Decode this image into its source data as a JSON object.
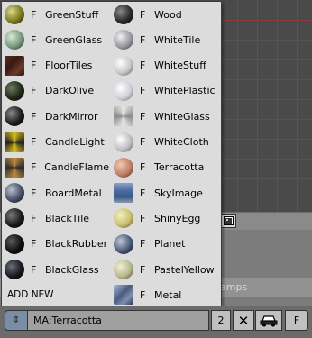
{
  "background": {
    "tab_label": "amps"
  },
  "popup": {
    "left_column": [
      {
        "flag": "F",
        "name": "GreenStuff",
        "thumb": "radial-gradient(circle at 35% 35%, #d9d98a, #7a7a20 55%, #2a2a05 90%)",
        "shape": "sphere"
      },
      {
        "flag": "F",
        "name": "GreenGlass",
        "thumb": "radial-gradient(circle at 35% 35%, #d8e8d0, #7a9a80 55%, #2e3e30 90%)",
        "shape": "sphere"
      },
      {
        "flag": "F",
        "name": "FloorTiles",
        "thumb": "linear-gradient(135deg, #5a2a1e, #3a1a12 40%, #6b3a2a 70%, #2a1410)",
        "shape": "square"
      },
      {
        "flag": "F",
        "name": "DarkOlive",
        "thumb": "radial-gradient(circle at 35% 35%, #6c7a5a, #1f2a18 55%, #050805 90%)",
        "shape": "sphere"
      },
      {
        "flag": "F",
        "name": "DarkMirror",
        "thumb": "radial-gradient(circle at 35% 35%, #8a8a8a, #1c1c1c 55%, #050505 90%)",
        "shape": "sphere"
      },
      {
        "flag": "F",
        "name": "CandleLight",
        "thumb": "conic-gradient(#d8c020, #1c1c1c, #d8c020, #1c1c1c, #d8c020)",
        "shape": "square"
      },
      {
        "flag": "F",
        "name": "CandleFlame",
        "thumb": "conic-gradient(#c08a40, #2a2a2a, #c08a40, #2a2a2a, #c08a40)",
        "shape": "square"
      },
      {
        "flag": "F",
        "name": "BoardMetal",
        "thumb": "radial-gradient(circle at 35% 35%, #b8c0d0, #4a5068 55%, #141824 90%)",
        "shape": "sphere"
      },
      {
        "flag": "F",
        "name": "BlackTile",
        "thumb": "radial-gradient(circle at 35% 35%, #7a7a7a, #1a1a1a 55%, #000 90%)",
        "shape": "sphere"
      },
      {
        "flag": "F",
        "name": "BlackRubber",
        "thumb": "radial-gradient(circle at 35% 35%, #5a5a5a, #101010 55%, #000 90%)",
        "shape": "sphere"
      },
      {
        "flag": "F",
        "name": "BlackGlass",
        "thumb": "radial-gradient(circle at 35% 35%, #6a6e78, #181a20 55%, #030305 90%)",
        "shape": "sphere"
      }
    ],
    "right_column": [
      {
        "flag": "F",
        "name": "Wood",
        "thumb": "radial-gradient(circle at 35% 35%, #8a8a8a, #2a2a2a 55%, #080808 90%)",
        "shape": "sphere"
      },
      {
        "flag": "F",
        "name": "WhiteTile",
        "thumb": "radial-gradient(circle at 35% 35%, #f0f0f0, #9a9aa0 55%, #4a4a50 90%)",
        "shape": "sphere"
      },
      {
        "flag": "F",
        "name": "WhiteStuff",
        "thumb": "radial-gradient(circle at 35% 35%, #ffffff, #c8c8c8 55%, #6a6a6a 90%)",
        "shape": "sphere"
      },
      {
        "flag": "F",
        "name": "WhitePlastic",
        "thumb": "radial-gradient(circle at 35% 35%, #ffffff, #d0d0d8 55%, #7a7a84 90%)",
        "shape": "sphere"
      },
      {
        "flag": "F",
        "name": "WhiteGlass",
        "thumb": "conic-gradient(#e8e8e8, #8a8a8a, #e8e8e8, #8a8a8a, #e8e8e8)",
        "shape": "square"
      },
      {
        "flag": "F",
        "name": "WhiteCloth",
        "thumb": "radial-gradient(circle at 35% 35%, #ffffff, #c0c0c0 55%, #707070 90%)",
        "shape": "sphere"
      },
      {
        "flag": "F",
        "name": "Terracotta",
        "thumb": "radial-gradient(circle at 35% 35%, #f0c8b0, #c08068 55%, #6a3a2a 90%)",
        "shape": "sphere"
      },
      {
        "flag": "F",
        "name": "SkyImage",
        "thumb": "linear-gradient(180deg, #8aa0c8, #4a6aa0 40%, #3a5888 70%, #8a9aa8)",
        "shape": "square"
      },
      {
        "flag": "F",
        "name": "ShinyEgg",
        "thumb": "radial-gradient(circle at 35% 35%, #f4f0c0, #c8c070 55%, #6a6430 90%)",
        "shape": "sphere"
      },
      {
        "flag": "F",
        "name": "Planet",
        "thumb": "radial-gradient(circle at 35% 35%, #c0c8d8, #4a5a7a 55%, #141a28 90%)",
        "shape": "sphere"
      },
      {
        "flag": "F",
        "name": "PastelYellow",
        "thumb": "radial-gradient(circle at 35% 35%, #f0f0d0, #b8b890 55%, #5a5a40 90%)",
        "shape": "sphere"
      },
      {
        "flag": "F",
        "name": "Metal",
        "thumb": "linear-gradient(135deg, #a8b8d0, #4a5a80 45%, #8090b0 70%, #2a3450)",
        "shape": "square"
      }
    ],
    "add_new_label": "ADD NEW"
  },
  "header": {
    "browse_icon": "updown-arrows-icon",
    "material_name": "MA:Terracotta",
    "users_count": "2",
    "delete_icon": "x-icon",
    "car_icon": "car-icon",
    "fake_user_label": "F"
  }
}
